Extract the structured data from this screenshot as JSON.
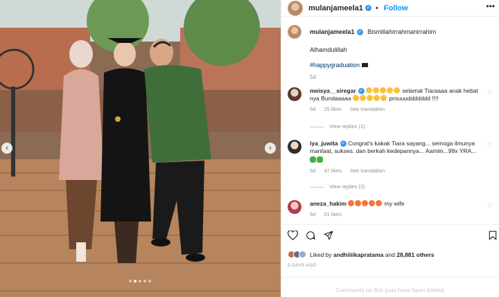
{
  "post": {
    "username": "mulanjameela1",
    "follow_label": "Follow",
    "more_label": "•••",
    "slide_count": 5,
    "active_slide": 2
  },
  "caption": {
    "username": "mulanjameela1",
    "line1": "Bismillahirrahmanirrahim",
    "line2": "Alhamdulillah",
    "hashtag": "#happygraduation",
    "time": "5d"
  },
  "comments": [
    {
      "username": "meisya__siregar",
      "verified": true,
      "text_a": "selamat Tiaraaaa anak hebat",
      "text_b": "nya Bundaaaaa",
      "text_c": "prouuuddddddd !!!!",
      "time": "5d",
      "likes": "25 likes",
      "translate": "See translation",
      "replies": "View replies (1)"
    },
    {
      "username": "iya_juwita",
      "verified": true,
      "text": "Congrat's kakak Tiara sayang... semoga ilmunya manfaat, sukses. dan berkah kedepannya... Aamiin...99x YRA...",
      "time": "5d",
      "likes": "37 likes",
      "translate": "See translation",
      "replies": "View replies (2)"
    },
    {
      "username": "aneza_hakim",
      "text": "my wife",
      "time": "5d",
      "likes": "21 likes"
    }
  ],
  "likes": {
    "prefix": "Liked by",
    "user": "andhiiiikapratama",
    "joiner": "and",
    "others": "28,881 others"
  },
  "date": "5 DAYS AGO",
  "limited": "Comments on this post have been limited.",
  "icons": {
    "like": "heart-icon",
    "comment": "comment-icon",
    "share": "paper-plane-icon",
    "save": "bookmark-icon"
  },
  "colors": {
    "link": "#0095f6",
    "verified": "#3897f0",
    "muted": "#8e8e8e"
  }
}
